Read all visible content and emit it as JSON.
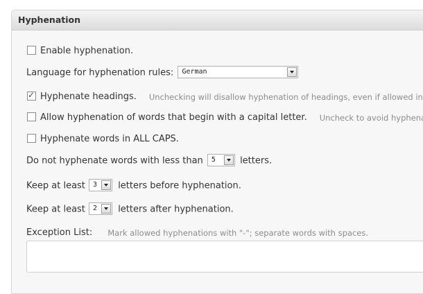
{
  "panel": {
    "title": "Hyphenation"
  },
  "options": {
    "enable": {
      "label": "Enable hyphenation.",
      "checked": false
    },
    "language": {
      "label": "Language for hyphenation rules:",
      "value": "German"
    },
    "headings": {
      "label": "Hyphenate headings.",
      "checked": true,
      "hint": "Unchecking will disallow hyphenation of headings, even if allowed in th"
    },
    "capital": {
      "label": "Allow hyphenation of words that begin with a capital letter.",
      "checked": false,
      "hint": "Uncheck to avoid hyphenati"
    },
    "allcaps": {
      "label": "Hyphenate words in ALL CAPS.",
      "checked": false
    },
    "min_length": {
      "prefix": "Do not hyphenate words with less than",
      "value": "5",
      "suffix": "letters."
    },
    "min_before": {
      "prefix": "Keep at least",
      "value": "3",
      "suffix": "letters before hyphenation."
    },
    "min_after": {
      "prefix": "Keep at least",
      "value": "2",
      "suffix": "letters after hyphenation."
    },
    "exceptions": {
      "label": "Exception List:",
      "hint": "Mark allowed hyphenations with \"-\"; separate words with spaces.",
      "value": ""
    }
  },
  "colors": {
    "panel_bg": "#f7f7f7",
    "hint_text": "#8c8c8c",
    "check_mark": "#2c4f7f"
  }
}
